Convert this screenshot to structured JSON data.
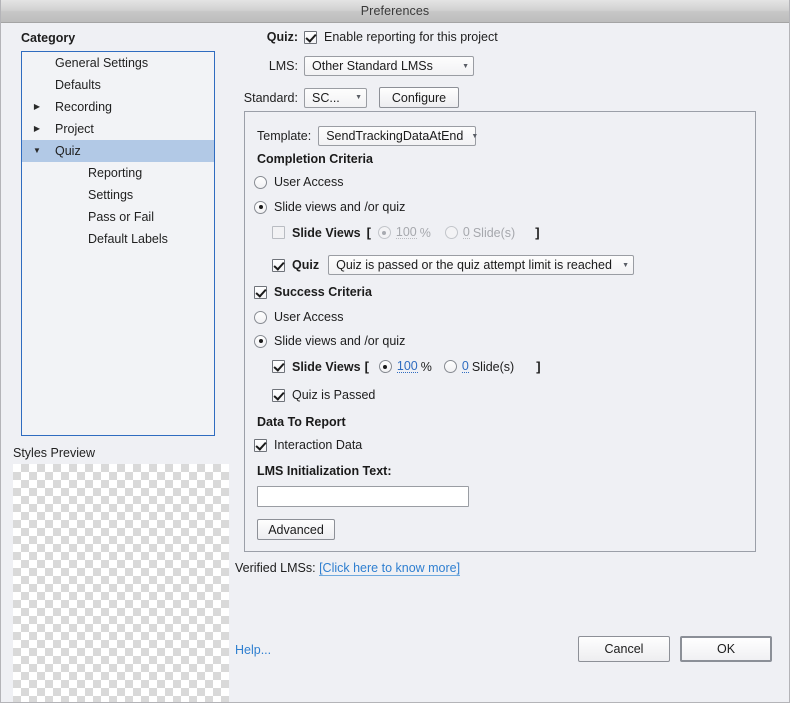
{
  "window": {
    "title": "Preferences"
  },
  "sidebar": {
    "header": "Category",
    "items": [
      {
        "label": "General Settings",
        "twisty": "",
        "child": false,
        "selected": false
      },
      {
        "label": "Defaults",
        "twisty": "",
        "child": false,
        "selected": false
      },
      {
        "label": "Recording",
        "twisty": "▶",
        "child": false,
        "selected": false
      },
      {
        "label": "Project",
        "twisty": "▶",
        "child": false,
        "selected": false
      },
      {
        "label": "Quiz",
        "twisty": "▼",
        "child": false,
        "selected": true
      },
      {
        "label": "Reporting",
        "twisty": "",
        "child": true,
        "selected": false
      },
      {
        "label": "Settings",
        "twisty": "",
        "child": true,
        "selected": false
      },
      {
        "label": "Pass or Fail",
        "twisty": "",
        "child": true,
        "selected": false
      },
      {
        "label": "Default Labels",
        "twisty": "",
        "child": true,
        "selected": false
      }
    ],
    "styles_preview_label": "Styles Preview"
  },
  "main": {
    "quiz_label": "Quiz:",
    "enable_reporting_label": "Enable reporting for this project",
    "enable_reporting_checked": true,
    "lms_label": "LMS:",
    "lms_value": "Other Standard LMSs",
    "standard_label": "Standard:",
    "standard_value": "SC...",
    "configure_button": "Configure",
    "template_label": "Template:",
    "template_value": "SendTrackingDataAtEnd",
    "completion": {
      "heading": "Completion Criteria",
      "user_access_label": "User Access",
      "user_access_selected": false,
      "slide_views_or_quiz_label": "Slide views and /or quiz",
      "slide_views_or_quiz_selected": true,
      "slide_views_label": "Slide Views",
      "slide_views_checked": false,
      "bracket_open": "[",
      "bracket_close": "]",
      "percent_value": "100",
      "percent_unit": "%",
      "percent_selected": true,
      "slides_value": "0",
      "slides_unit": "Slide(s)",
      "slides_selected": false,
      "quiz_label": "Quiz",
      "quiz_checked": true,
      "quiz_condition": "Quiz is passed or the quiz attempt limit is reached"
    },
    "success": {
      "heading": "Success Criteria",
      "heading_checked": true,
      "user_access_label": "User Access",
      "user_access_selected": false,
      "slide_views_or_quiz_label": "Slide views and /or quiz",
      "slide_views_or_quiz_selected": true,
      "slide_views_label": "Slide Views",
      "slide_views_checked": true,
      "bracket_open": "[",
      "bracket_close": "]",
      "percent_value": "100",
      "percent_unit": "%",
      "percent_selected": true,
      "slides_value": "0",
      "slides_unit": "Slide(s)",
      "slides_selected": false,
      "quiz_passed_label": "Quiz is Passed",
      "quiz_passed_checked": true
    },
    "data_to_report": {
      "heading": "Data To Report",
      "interaction_data_label": "Interaction Data",
      "interaction_data_checked": true
    },
    "lms_init": {
      "label": "LMS Initialization Text:",
      "value": "",
      "placeholder": ""
    },
    "advanced_button": "Advanced",
    "verified_lms_label": "Verified LMSs:",
    "verified_lms_link": "[Click here to know more]"
  },
  "footer": {
    "help_label": "Help...",
    "cancel_label": "Cancel",
    "ok_label": "OK"
  },
  "colors": {
    "accent_blue": "#2f6cc0",
    "link_blue": "#2f7fd0",
    "selection": "#b2c9e6",
    "background": "#eff0f4"
  }
}
